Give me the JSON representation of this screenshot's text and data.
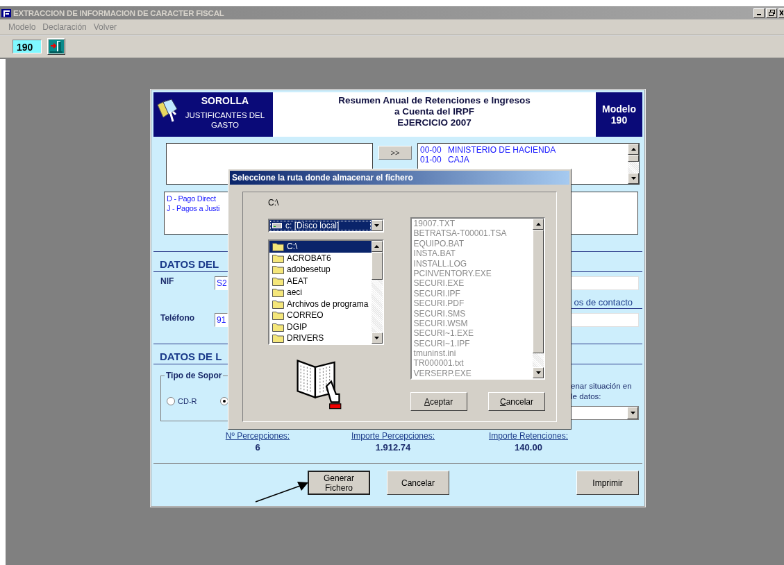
{
  "window": {
    "title": "EXTRACCION DE INFORMACION DE CARACTER FISCAL"
  },
  "menu": [
    "Modelo",
    "Declaración",
    "Volver"
  ],
  "toolbar": {
    "model_field": "190"
  },
  "form": {
    "header": {
      "app_name": "SOROLLA",
      "subtitle": "JUSTIFICANTES DEL GASTO",
      "title_lines": [
        "Resumen Anual de Retenciones e Ingresos",
        "a Cuenta del IRPF",
        "EJERCICIO 2007"
      ],
      "model_label": "Modelo",
      "model_number": "190"
    },
    "move_button": ">>",
    "organisms": [
      {
        "code": "00-00",
        "name": "MINISTERIO DE HACIENDA"
      },
      {
        "code": "01-00",
        "name": "CAJA"
      }
    ],
    "payment_types": [
      "D - Pago Direct",
      "J - Pagos a Justi"
    ],
    "section_1": "DATOS DEL",
    "nif": {
      "label": "NIF",
      "value": "S2"
    },
    "contact_link": "os de contacto",
    "telefono": {
      "label": "Teléfono",
      "value": "91"
    },
    "section_2": "DATOS DE L",
    "support_group": {
      "label": "Tipo de Sopor",
      "options": [
        {
          "label": "CD-R",
          "selected": false
        },
        {
          "selected": true
        }
      ]
    },
    "situation_label": [
      "enar situación en",
      "le datos:"
    ],
    "totals": [
      {
        "label": "Nº Percepciones:",
        "value": "6"
      },
      {
        "label": "Importe Percepciones:",
        "value": "1.912.74"
      },
      {
        "label": "Importe Retenciones:",
        "value": "140.00"
      }
    ],
    "buttons": [
      {
        "label": "Generar Fichero",
        "kind": "generate"
      },
      {
        "label": "Cancelar",
        "kind": "cancel"
      },
      {
        "label": "Imprimir",
        "kind": "print"
      }
    ]
  },
  "dialog": {
    "title": "Seleccione la ruta donde almacenar el fichero",
    "current_path": "C:\\",
    "drive": "c: [Disco local]",
    "folders": [
      {
        "name": "C:\\",
        "selected": true
      },
      {
        "name": "ACROBAT6",
        "selected": false
      },
      {
        "name": "adobesetup",
        "selected": false
      },
      {
        "name": "AEAT",
        "selected": false
      },
      {
        "name": "aeci",
        "selected": false
      },
      {
        "name": "Archivos de programa",
        "selected": false
      },
      {
        "name": "CORREO",
        "selected": false
      },
      {
        "name": "DGIP",
        "selected": false
      },
      {
        "name": "DRIVERS",
        "selected": false
      }
    ],
    "files": [
      "19007.TXT",
      "BETRATSA-T00001.TSA",
      "EQUIPO.BAT",
      "INSTA.BAT",
      "INSTALL.LOG",
      "PCINVENTORY.EXE",
      "SECURI.EXE",
      "SECURI.IPF",
      "SECURI.PDF",
      "SECURI.SMS",
      "SECURI.WSM",
      "SECURI~1.EXE",
      "SECURI~1.IPF",
      "tmuninst.ini",
      "TR000001.txt",
      "VERSERP.EXE"
    ],
    "buttons": [
      {
        "mnemonic": "A",
        "rest": "ceptar"
      },
      {
        "mnemonic": "C",
        "rest": "ancelar"
      }
    ]
  }
}
